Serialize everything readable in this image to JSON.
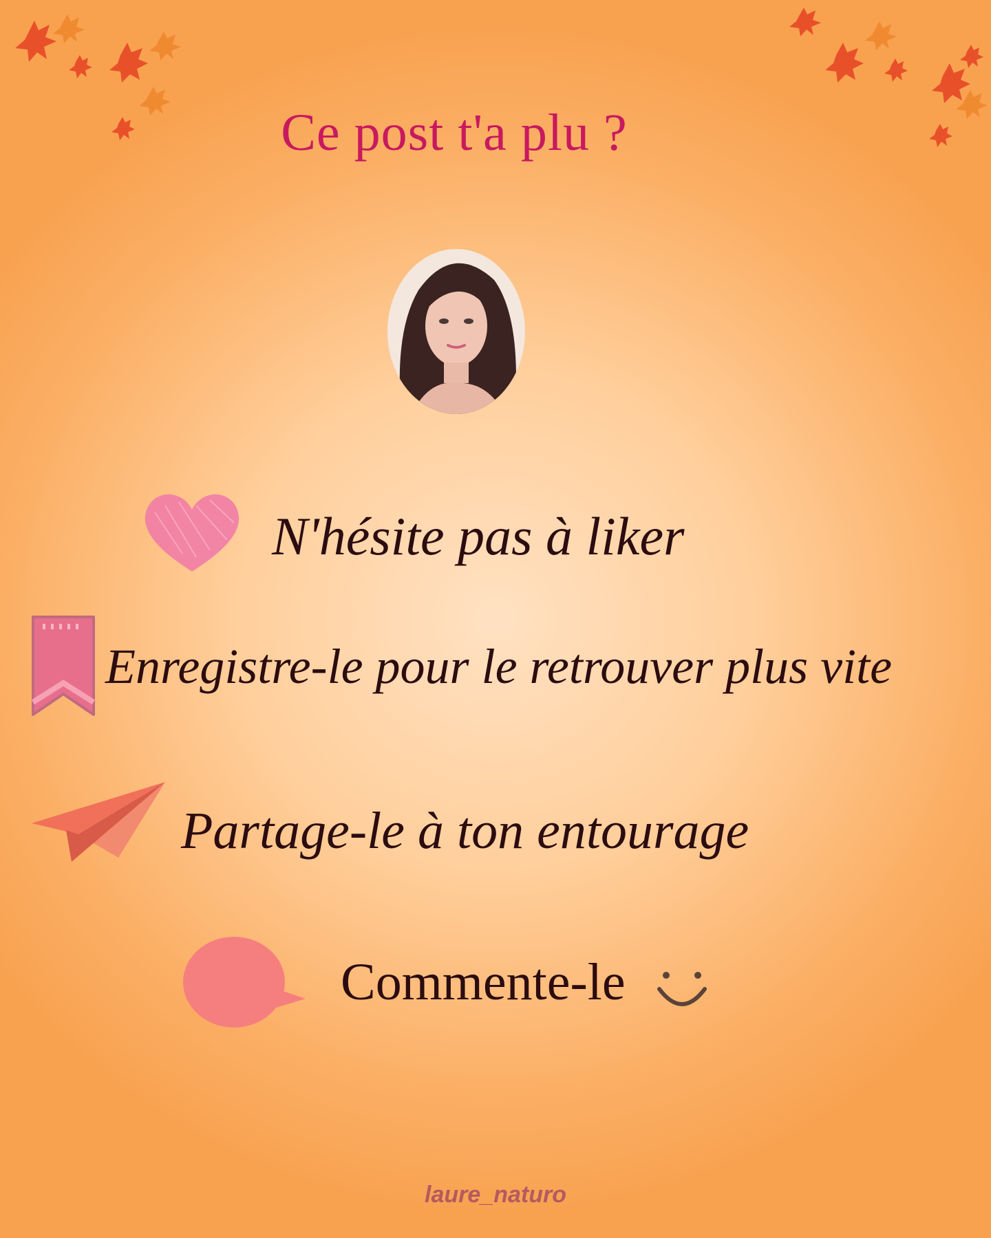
{
  "title": "Ce post t'a plu ?",
  "actions": [
    {
      "icon": "heart-icon",
      "label": "N'hésite pas à liker"
    },
    {
      "icon": "bookmark-icon",
      "label": "Enregistre-le pour le retrouver plus vite"
    },
    {
      "icon": "paper-plane-icon",
      "label": "Partage-le à ton entourage"
    },
    {
      "icon": "comment-bubble-icon",
      "label": "Commente-le"
    }
  ],
  "handle": "laure_naturo",
  "colors": {
    "title": "#c8195f",
    "text": "#2b0c10",
    "heart": "#f078a8",
    "bookmark": "#e86f8c",
    "plane": "#f0705a",
    "bubble": "#f57f7e",
    "handle": "#b55a60",
    "background_center": "#ffe1c2",
    "background_edge": "#f8a250"
  }
}
